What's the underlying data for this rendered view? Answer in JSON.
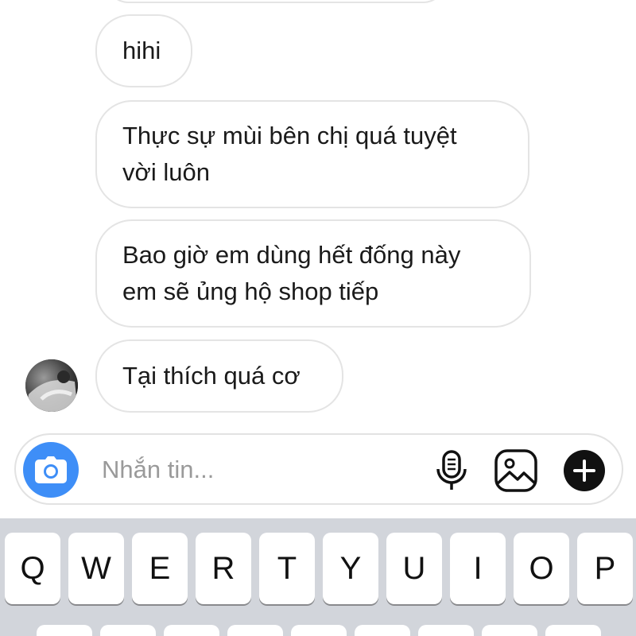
{
  "chat": {
    "messages": [
      {
        "text": "hihi"
      },
      {
        "text": "Thực sự mùi bên chị quá tuyệt\nvời luôn"
      },
      {
        "text": "Bao giờ em dùng hết đống này\nem sẽ ủng hộ shop tiếp"
      },
      {
        "text": "Tại thích quá cơ"
      }
    ]
  },
  "composer": {
    "placeholder": "Nhắn tin...",
    "value": "",
    "camera_icon": "camera-icon",
    "mic_icon": "microphone-icon",
    "gallery_icon": "image-icon",
    "plus_icon": "plus-circle-icon",
    "accent_color": "#3e8ef7"
  },
  "keyboard": {
    "row1": [
      "Q",
      "W",
      "E",
      "R",
      "T",
      "Y",
      "U",
      "I",
      "O",
      "P"
    ]
  }
}
